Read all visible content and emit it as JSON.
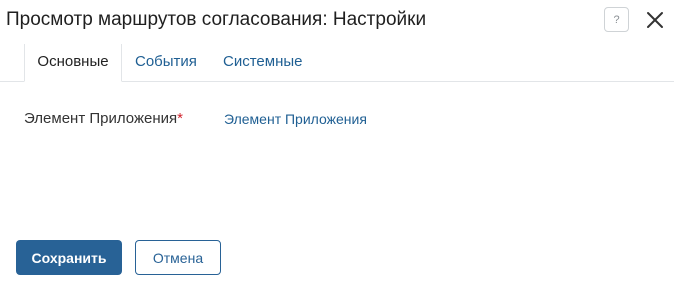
{
  "dialog": {
    "title": "Просмотр маршрутов согласования: Настройки",
    "help_icon": "help-icon",
    "help_glyph": "?",
    "close_icon": "close-icon"
  },
  "tabs": [
    {
      "label": "Основные",
      "active": true
    },
    {
      "label": "События",
      "active": false
    },
    {
      "label": "Системные",
      "active": false
    }
  ],
  "form": {
    "field_label": "Элемент Приложения",
    "required_mark": "*",
    "field_value": "Элемент Приложения"
  },
  "footer": {
    "save_label": "Сохранить",
    "cancel_label": "Отмена"
  },
  "colors": {
    "accent": "#286296",
    "link": "#1f5f93",
    "required": "#d0212b",
    "border": "#e2e5e8"
  }
}
